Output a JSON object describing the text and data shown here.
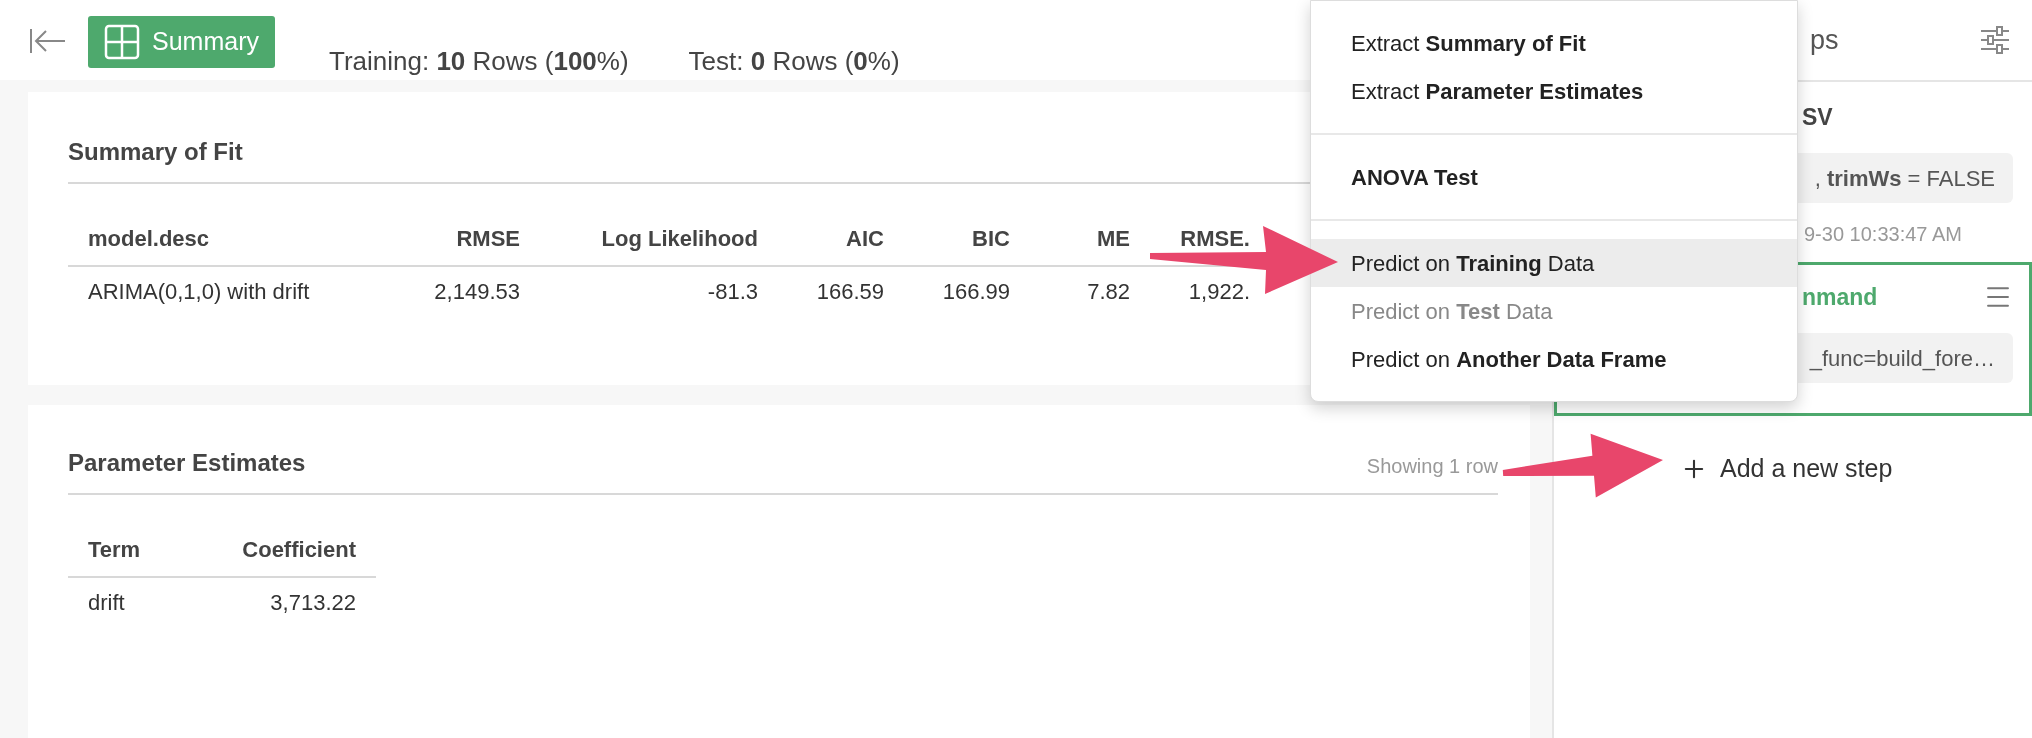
{
  "toolbar": {
    "summary_tab": "Summary",
    "training": "Training: **10** Rows (**100**%)",
    "test": "Test: **0** Rows (**0**%)"
  },
  "summary_of_fit": {
    "title": "Summary of Fit",
    "columns": [
      "model.desc",
      "RMSE",
      "Log Likelihood",
      "AIC",
      "BIC",
      "ME",
      "RMSE."
    ],
    "rows": [
      [
        "ARIMA(0,1,0) with drift",
        "2,149.53",
        "-81.3",
        "166.59",
        "166.99",
        "7.82",
        "1,922."
      ]
    ]
  },
  "parameter_estimates": {
    "title": "Parameter Estimates",
    "row_count": "Showing 1 row",
    "columns": [
      "Term",
      "Coefficient"
    ],
    "rows": [
      [
        "drift",
        "3,713.22"
      ]
    ]
  },
  "steps_panel": {
    "title": "ps",
    "steps": [
      {
        "title": "SV",
        "code": ", **trimWs** = FALSE",
        "timestamp": "9-30 10:33:47 AM",
        "selected": false
      },
      {
        "title": "nmand",
        "code": "_func=build_fore…",
        "selected": true
      }
    ],
    "add_step": "Add a new step"
  },
  "menu": {
    "groups": [
      [
        {
          "label": "Extract **Summary of Fit**",
          "selected": false,
          "disabled": false
        },
        {
          "label": "Extract **Parameter Estimates**",
          "selected": false,
          "disabled": false
        }
      ],
      [
        {
          "label": "**ANOVA Test**",
          "selected": false,
          "disabled": false
        }
      ],
      [
        {
          "label": "Predict on **Training** Data",
          "selected": true,
          "disabled": false
        },
        {
          "label": "Predict on **Test** Data",
          "selected": false,
          "disabled": true
        },
        {
          "label": "Predict on **Another Data Frame**",
          "selected": false,
          "disabled": false
        }
      ]
    ]
  }
}
